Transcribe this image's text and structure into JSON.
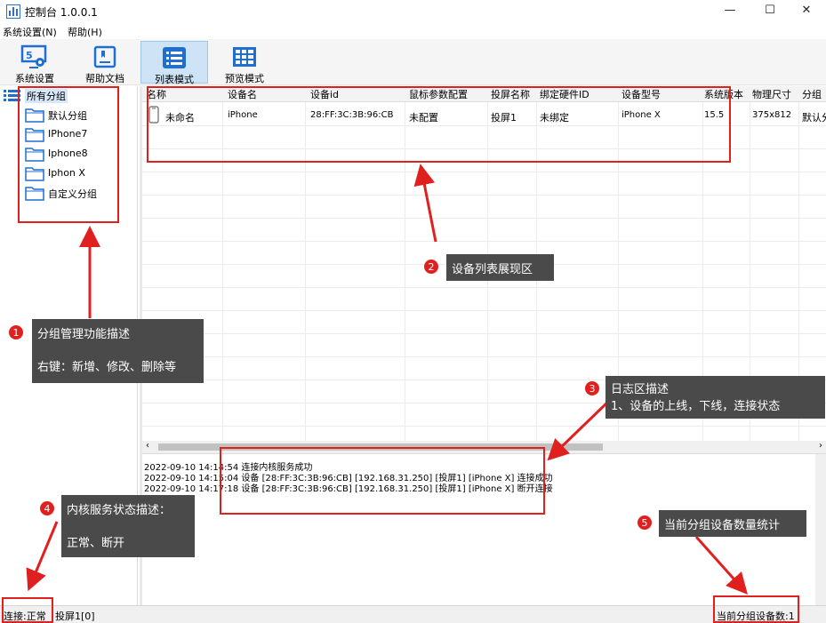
{
  "window": {
    "title": "控制台 1.0.0.1",
    "minimize": "—",
    "maximize": "☐",
    "close": "✕"
  },
  "menu": [
    {
      "label": "系统设置(N)"
    },
    {
      "label": "帮助(H)"
    }
  ],
  "toolbar": [
    {
      "label": "系统设置",
      "icon": "settings-icon"
    },
    {
      "label": "帮助文档",
      "icon": "book-icon"
    },
    {
      "label": "列表模式",
      "icon": "list-icon",
      "active": true
    },
    {
      "label": "预览模式",
      "icon": "grid-icon"
    }
  ],
  "tree": {
    "root": "所有分组",
    "items": [
      "默认分组",
      "IPhone7",
      "Iphone8",
      "Iphon X",
      "自定义分组"
    ]
  },
  "grid": {
    "columns": [
      "名称",
      "设备名",
      "设备id",
      "鼠标参数配置",
      "投屏名称",
      "绑定硬件ID",
      "设备型号",
      "系统版本",
      "物理尺寸",
      "分组"
    ],
    "rows": [
      {
        "name": "未命名",
        "device_name": "iPhone",
        "device_id": "28:FF:3C:3B:96:CB",
        "mouse_config": "未配置",
        "screen_name": "投屏1",
        "hardware_id": "未绑定",
        "model": "iPhone X",
        "os_version": "15.5",
        "size": "375x812",
        "group": "默认分"
      }
    ]
  },
  "log": {
    "lines": [
      "2022-09-10 14:14:54  连接内核服务成功",
      "2022-09-10 14:15:04  设备 [28:FF:3C:3B:96:CB]  [192.168.31.250]  [投屏1]  [iPhone X]  连接成功",
      "2022-09-10 14:17:18  设备 [28:FF:3C:3B:96:CB]  [192.168.31.250]  [投屏1]  [iPhone X]  断开连接"
    ]
  },
  "status": {
    "connection": "连接:正常",
    "screen": "投屏1[0]",
    "device_count": "当前分组设备数:1"
  },
  "annotations": [
    {
      "num": "1",
      "line1": "分组管理功能描述",
      "line2": "右键：新增、修改、删除等"
    },
    {
      "num": "2",
      "line1": "设备列表展现区"
    },
    {
      "num": "3",
      "line1": "日志区描述",
      "line2": "1、设备的上线，下线，连接状态"
    },
    {
      "num": "4",
      "line1": "内核服务状态描述：",
      "line2": "正常、断开"
    },
    {
      "num": "5",
      "line1": "当前分组设备数量统计"
    }
  ],
  "colors": {
    "highlight": "#e0201f",
    "callout": "#4a4a4a",
    "accent": "#2f6fc6",
    "active_tool": "#cfe3f7"
  }
}
